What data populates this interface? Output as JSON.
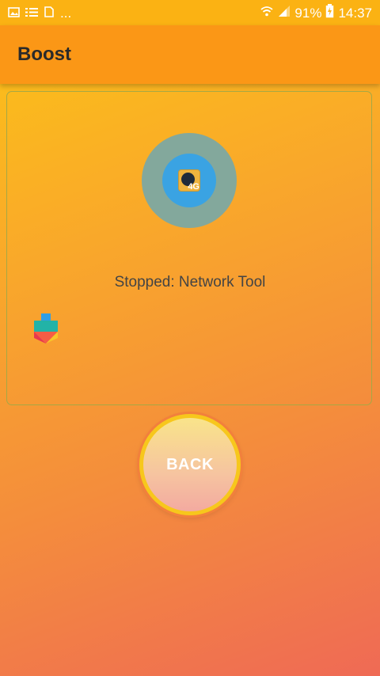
{
  "status_bar": {
    "battery": "91%",
    "time": "14:37",
    "more_indicator": "...",
    "icons": [
      "gallery-icon",
      "list-icon",
      "doc-icon",
      "wifi-icon",
      "signal-icon",
      "battery-charging-icon"
    ]
  },
  "app_bar": {
    "title": "Boost"
  },
  "boost_card": {
    "current_app_icon": "4g-network-app-icon",
    "current_app_badge": "4G",
    "status": "Stopped: Network Tool",
    "queued_app_icon": "google-play-services-icon"
  },
  "actions": {
    "back_label": "BACK"
  },
  "colors": {
    "status_bar": "#fbb213",
    "app_bar": "#fb9716",
    "ring_outer": "#83a89c",
    "ring_inner": "#3aa3e3",
    "card_border": "#a6a844"
  }
}
